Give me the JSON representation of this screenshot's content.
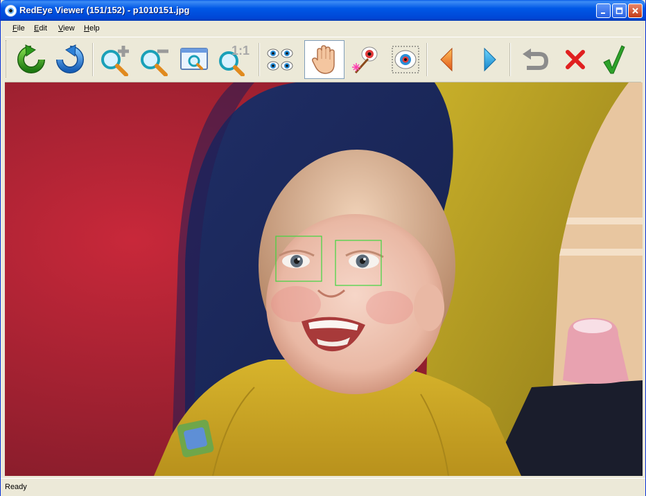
{
  "window": {
    "title": "RedEye Viewer (151/152) - p1010151.jpg",
    "controls": {
      "minimize": "_",
      "maximize": "□",
      "close": "✕"
    }
  },
  "menu": [
    {
      "label": "File",
      "accel": "F",
      "rest": "ile"
    },
    {
      "label": "Edit",
      "accel": "E",
      "rest": "dit"
    },
    {
      "label": "View",
      "accel": "V",
      "rest": "iew"
    },
    {
      "label": "Help",
      "accel": "H",
      "rest": "elp"
    }
  ],
  "toolbar": {
    "tools": [
      {
        "icon": "rotate-left-icon"
      },
      {
        "icon": "rotate-right-icon"
      },
      {
        "icon": "zoom-in-icon"
      },
      {
        "icon": "zoom-out-icon"
      },
      {
        "icon": "zoom-fit-window-icon"
      },
      {
        "icon": "zoom-actual-size-icon",
        "text": "1:1"
      },
      {
        "icon": "detect-eyes-icon"
      },
      {
        "icon": "hand-pan-icon",
        "active": true
      },
      {
        "icon": "magic-wand-eye-icon"
      },
      {
        "icon": "select-eye-icon"
      },
      {
        "icon": "previous-arrow-icon"
      },
      {
        "icon": "next-arrow-icon"
      },
      {
        "icon": "undo-icon"
      },
      {
        "icon": "reject-icon"
      },
      {
        "icon": "accept-icon"
      }
    ]
  },
  "image": {
    "subject": "photo",
    "eye_boxes": 2,
    "box_color": "#3fd63f"
  },
  "status": {
    "text": "Ready"
  },
  "colors": {
    "accent": "#0058e6",
    "chrome": "#ece9d8"
  }
}
